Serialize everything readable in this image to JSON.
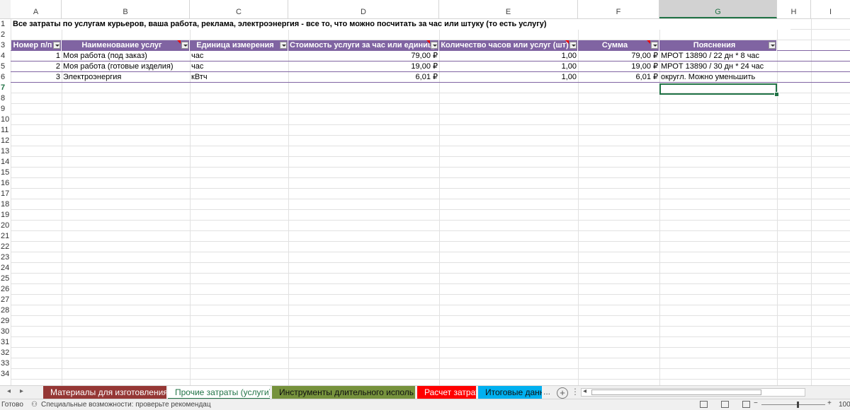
{
  "columns": [
    "A",
    "B",
    "C",
    "D",
    "E",
    "F",
    "G",
    "H",
    "I"
  ],
  "selected_column": "G",
  "rows": [
    "1",
    "2",
    "3",
    "4",
    "5",
    "6",
    "7",
    "8",
    "9",
    "10",
    "11",
    "12",
    "13",
    "14",
    "15",
    "16",
    "17",
    "18",
    "19",
    "20",
    "21",
    "22",
    "23",
    "24",
    "25",
    "26",
    "27",
    "28",
    "29",
    "30",
    "31",
    "32",
    "33",
    "34"
  ],
  "selected_row": "7",
  "title_text": "Все затраты по услугам курьеров, ваша работа, реклама, электроэнергия - все то, что можно посчитать за час или штуку (то есть услугу)",
  "table": {
    "headers": [
      "Номер п/п",
      "Наименование услуг",
      "Единица измерения",
      "Стоимость услуги за час или единицу",
      "Количество часов или услуг (шт)",
      "Сумма",
      "Пояснения"
    ],
    "rows": [
      [
        "1",
        "Моя работа (под заказ)",
        "час",
        "79,00 ₽",
        "1,00",
        "79,00 ₽",
        "МРОТ 13890 / 22 дн * 8 час"
      ],
      [
        "2",
        "Моя работа (готовые изделия)",
        "час",
        "19,00 ₽",
        "1,00",
        "19,00 ₽",
        "МРОТ 13890 / 30 дн * 24 час"
      ],
      [
        "3",
        "Электроэнергия",
        "кВтч",
        "6,01 ₽",
        "1,00",
        "6,01 ₽",
        "округл. Можно уменьшить"
      ]
    ]
  },
  "colors": {
    "table_header": "#8064a2",
    "accent": "#217346"
  },
  "sheet_tabs": [
    {
      "label": "Материалы для изготовления",
      "color": "#953735"
    },
    {
      "label": "Прочие затраты (услуги)",
      "color": "#ffffff",
      "active": true
    },
    {
      "label": "Инструменты длительного исполь",
      "color": "#76923c"
    },
    {
      "label": "Расчет затрат",
      "color": "#ff0000"
    },
    {
      "label": "Итоговые данн",
      "color": "#00b0f0"
    }
  ],
  "more_tabs_label": "...",
  "status": {
    "ready": "Готово",
    "accessibility": "Специальные возможности: проверьте рекомендац",
    "zoom": "100"
  }
}
